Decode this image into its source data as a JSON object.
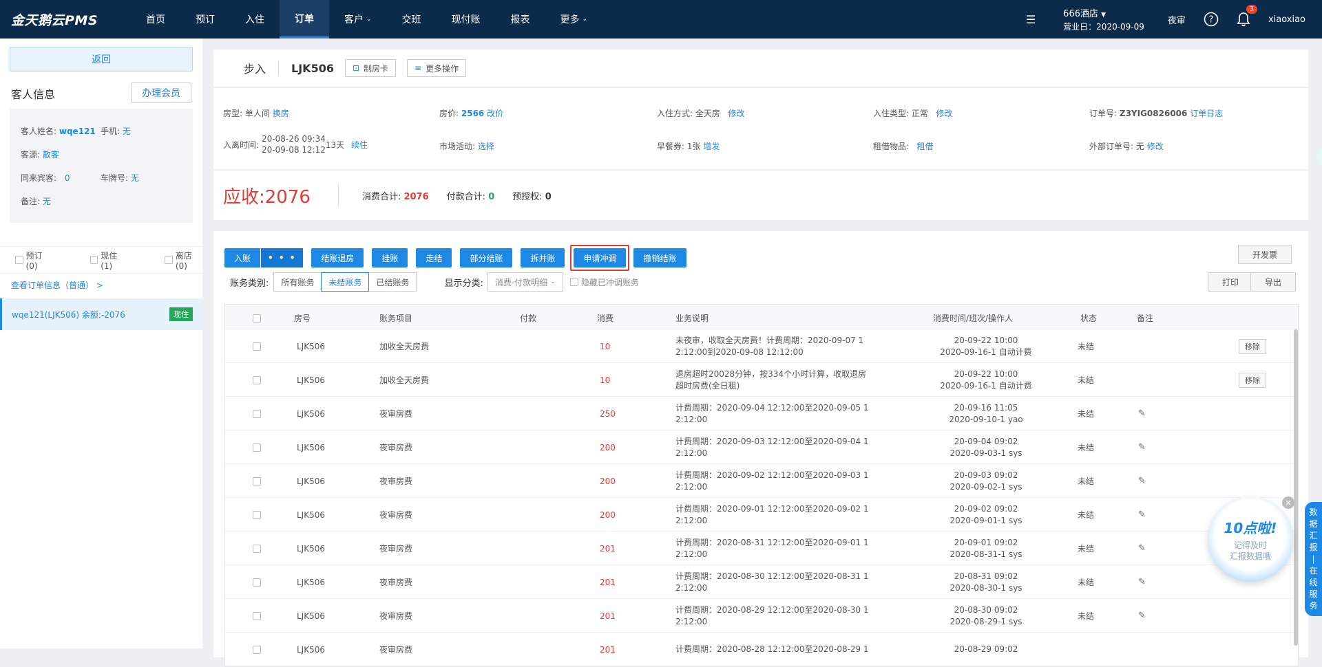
{
  "topbar": {
    "logo": "金天鹅云PMS",
    "nav": [
      {
        "label": "首页",
        "caret": false
      },
      {
        "label": "预订",
        "caret": false
      },
      {
        "label": "入住",
        "caret": false
      },
      {
        "label": "订单",
        "caret": false,
        "active": true
      },
      {
        "label": "客户",
        "caret": true
      },
      {
        "label": "交班",
        "caret": false
      },
      {
        "label": "现付账",
        "caret": false
      },
      {
        "label": "报表",
        "caret": false
      },
      {
        "label": "更多",
        "caret": true
      }
    ],
    "hotel_name": "666酒店",
    "business_date": "营业日：2020-09-09",
    "night_audit": "夜审",
    "notification_count": "3",
    "username": "xiaoxiao"
  },
  "sidebar": {
    "back": "返回",
    "guest_info_title": "客人信息",
    "member_btn": "办理会员",
    "guest_name_label": "客人姓名:",
    "guest_name": "wqe121",
    "phone_label": "手机:",
    "phone": "无",
    "source_label": "客源:",
    "source": "散客",
    "companions_label": "同来宾客:",
    "companions": "0",
    "plate_label": "车牌号:",
    "plate": "无",
    "remark_label": "备注:",
    "remark": "无",
    "status_filters": [
      "预订(0)",
      "现住(1)",
      "离店(0)"
    ],
    "view_order": "查看订单信息（普通） >",
    "room_item": "wqe121(LJK506)  余额:-2076",
    "room_tag": "现住"
  },
  "header": {
    "checkin_type": "步入",
    "room_no": "LJK506",
    "make_card": "制房卡",
    "more_ops": "更多操作"
  },
  "info": {
    "room_type_label": "房型:",
    "room_type": "单人间",
    "change_room": "换房",
    "price_label": "房价:",
    "price": "2566",
    "change_price": "改价",
    "checkin_mode_label": "入住方式:",
    "checkin_mode": "全天房",
    "modify": "修改",
    "checkin_type_label": "入住类型:",
    "checkin_type": "正常",
    "order_no_label": "订单号:",
    "order_no": "Z3YIG0826006",
    "order_log": "订单日志",
    "stay_label": "入离时间:",
    "stay_in": "20-08-26 09:34",
    "stay_out": "20-09-08 12:12",
    "nights": "13天",
    "extend": "续住",
    "market_label": "市场活动:",
    "market": "选择",
    "breakfast_label": "早餐券:",
    "breakfast": "1张",
    "breakfast_add": "增发",
    "rental_label": "租借物品:",
    "rental": "租借",
    "ext_order_label": "外部订单号:",
    "ext_order": "无"
  },
  "receivable": {
    "label": "应收:",
    "amount": "2076",
    "consume_label": "消费合计:",
    "consume": "2076",
    "pay_label": "付款合计:",
    "pay": "0",
    "preauth_label": "预授权:",
    "preauth": "0"
  },
  "actions": {
    "post": "入账",
    "post_more": "• • •",
    "checkout": "结账退房",
    "hang": "挂账",
    "walk": "走结",
    "partial": "部分结账",
    "split": "拆并账",
    "apply_reverse": "申请冲调",
    "cancel_checkout": "撤销结账",
    "invoice": "开发票",
    "print": "打印",
    "export": "导出"
  },
  "filter": {
    "category_label": "账务类别:",
    "categories": [
      "所有账务",
      "未结账务",
      "已结账务"
    ],
    "display_label": "显示分类:",
    "display_value": "消费-付款明细",
    "hide_reversed": "隐藏已冲调账务"
  },
  "table": {
    "headers": [
      "房号",
      "账务项目",
      "付款",
      "消费",
      "业务说明",
      "消费时间/班次/操作人",
      "状态",
      "备注"
    ],
    "remove_label": "移除",
    "rows": [
      {
        "room": "LJK506",
        "item": "加收全天房费",
        "pay": "",
        "consume": "10",
        "desc1": "未夜审，收取全天房费！计费周期：2020-09-07 1",
        "desc2": "2:12:00到2020-09-08 12:12:00",
        "time1": "20-09-22 10:00",
        "time2": "2020-09-16-1 自动计费",
        "status": "未结",
        "action": "remove"
      },
      {
        "room": "LJK506",
        "item": "加收全天房费",
        "pay": "",
        "consume": "10",
        "desc1": "退房超时20028分钟，按334个小时计算，收取退房",
        "desc2": "超时房费(全日租)",
        "time1": "20-09-22 10:00",
        "time2": "2020-09-16-1 自动计费",
        "status": "未结",
        "action": "remove"
      },
      {
        "room": "LJK506",
        "item": "夜审房费",
        "pay": "",
        "consume": "250",
        "desc1": "计费周期：2020-09-04 12:12:00至2020-09-05 1",
        "desc2": "2:12:00",
        "time1": "20-09-16 11:05",
        "time2": "2020-09-10-1 yao",
        "status": "未结",
        "action": "edit"
      },
      {
        "room": "LJK506",
        "item": "夜审房费",
        "pay": "",
        "consume": "200",
        "desc1": "计费周期：2020-09-03 12:12:00至2020-09-04 1",
        "desc2": "2:12:00",
        "time1": "20-09-04 09:02",
        "time2": "2020-09-03-1 sys",
        "status": "未结",
        "action": "edit"
      },
      {
        "room": "LJK506",
        "item": "夜审房费",
        "pay": "",
        "consume": "200",
        "desc1": "计费周期：2020-09-02 12:12:00至2020-09-03 1",
        "desc2": "2:12:00",
        "time1": "20-09-03 09:02",
        "time2": "2020-09-02-1 sys",
        "status": "未结",
        "action": "edit"
      },
      {
        "room": "LJK506",
        "item": "夜审房费",
        "pay": "",
        "consume": "200",
        "desc1": "计费周期：2020-09-01 12:12:00至2020-09-02 1",
        "desc2": "2:12:00",
        "time1": "20-09-02 09:02",
        "time2": "2020-09-01-1 sys",
        "status": "未结",
        "action": "edit"
      },
      {
        "room": "LJK506",
        "item": "夜审房费",
        "pay": "",
        "consume": "201",
        "desc1": "计费周期：2020-08-31 12:12:00至2020-09-01 1",
        "desc2": "2:12:00",
        "time1": "20-09-01 09:02",
        "time2": "2020-08-31-1 sys",
        "status": "未结",
        "action": "edit"
      },
      {
        "room": "LJK506",
        "item": "夜审房费",
        "pay": "",
        "consume": "201",
        "desc1": "计费周期：2020-08-30 12:12:00至2020-08-31 1",
        "desc2": "2:12:00",
        "time1": "20-08-31 09:02",
        "time2": "2020-08-30-1 sys",
        "status": "未结",
        "action": "edit"
      },
      {
        "room": "LJK506",
        "item": "夜审房费",
        "pay": "",
        "consume": "201",
        "desc1": "计费周期：2020-08-29 12:12:00至2020-08-30 1",
        "desc2": "2:12:00",
        "time1": "20-08-30 09:02",
        "time2": "2020-08-29-1 sys",
        "status": "未结",
        "action": "edit"
      },
      {
        "room": "LJK506",
        "item": "夜审房费",
        "pay": "",
        "consume": "201",
        "desc1": "计费周期：2020-08-28 12:12:00至2020-08-29 1",
        "desc2": "",
        "time1": "20-08-29 09:02",
        "time2": "",
        "status": "",
        "action": ""
      }
    ]
  },
  "float_ad": {
    "title": "10点啦!",
    "line1": "记得及时",
    "line2": "汇报数据哦",
    "close": "×"
  },
  "side_tab": [
    "数",
    "据",
    "汇",
    "报",
    "|",
    "在",
    "线",
    "服",
    "务"
  ],
  "colors": {
    "nav_bg": "#0c2b4a",
    "accent": "#1e88e5",
    "danger": "#e53935",
    "success": "#26a65b"
  }
}
